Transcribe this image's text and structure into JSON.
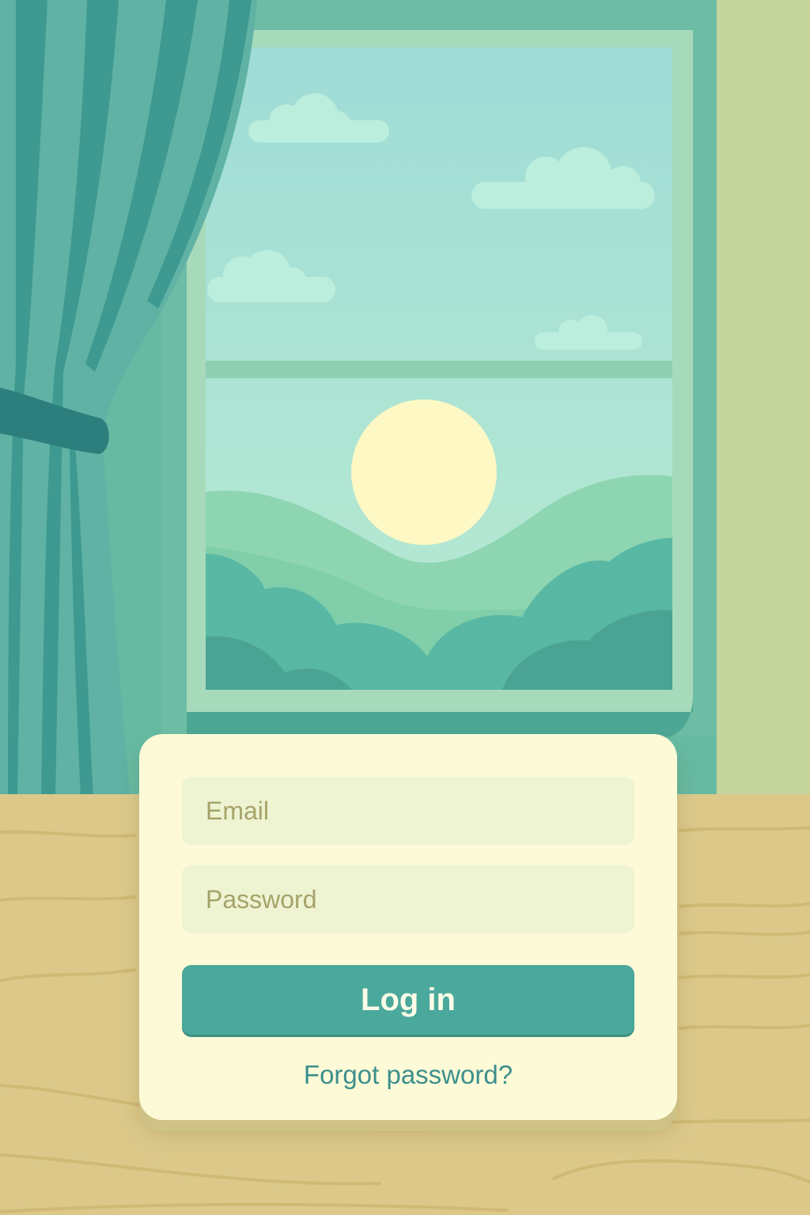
{
  "login_form": {
    "email_placeholder": "Email",
    "password_placeholder": "Password",
    "login_button_label": "Log in",
    "forgot_password_label": "Forgot password?"
  },
  "colors": {
    "card_background": "#fdfad8",
    "field_background": "#eef3d2",
    "accent": "#4ba89c",
    "link": "#3c8f8c",
    "wall": "#67baa2",
    "table": "#dcc98a"
  },
  "scene": {
    "illustration": "window-with-sun-and-hills",
    "curtain": "teal-curtain"
  }
}
